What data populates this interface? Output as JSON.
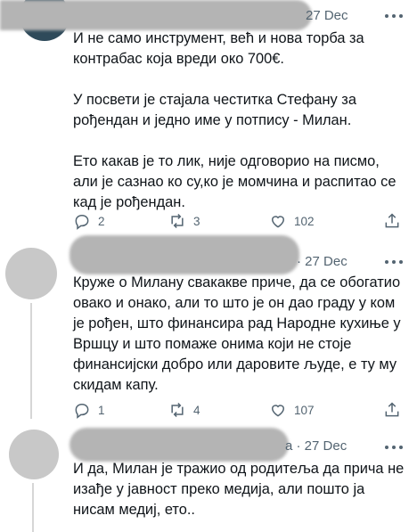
{
  "tweets": [
    {
      "name_hidden": true,
      "date": "27 Dec",
      "text": "И не само инструмент, већ и нова торба за контрабас која вреди око 700€.\n\nУ посвети је стајала честитка Стефану за рођендан и једно име у потпису - Милан.\n\nЕто какав је то лик, није одговорио на писмо, али је сазнао ко су,ко је момчина и распитао се кад је рођендан.",
      "replies": "2",
      "retweets": "3",
      "likes": "102"
    },
    {
      "name_hidden": true,
      "date": "· 27 Dec",
      "text": "Круже о Милану свакакве приче, да се обогатио овако и онако, али то што је он дао граду у ком је рођен, што финансира рад Народне кухиње у Вршцу и што помаже онима који не стоје финансијски добро или даровите људе, е ту му скидам капу.",
      "replies": "1",
      "retweets": "4",
      "likes": "107"
    },
    {
      "name_hidden": true,
      "date": "a · 27 Dec",
      "text": "И да, Милан је тражио од родитеља да прича не изађе у јавност преко медија, али пошто ја нисам медиј, ето..",
      "replies": "",
      "retweets": "",
      "likes": ""
    }
  ],
  "icons": [
    "reply-icon",
    "retweet-icon",
    "like-icon",
    "share-icon",
    "more-icon"
  ],
  "colors": {
    "text": "#0f1419",
    "muted": "#536471",
    "redaction": "#b4b4b4",
    "avatar_placeholder": "#c8c8c8"
  }
}
